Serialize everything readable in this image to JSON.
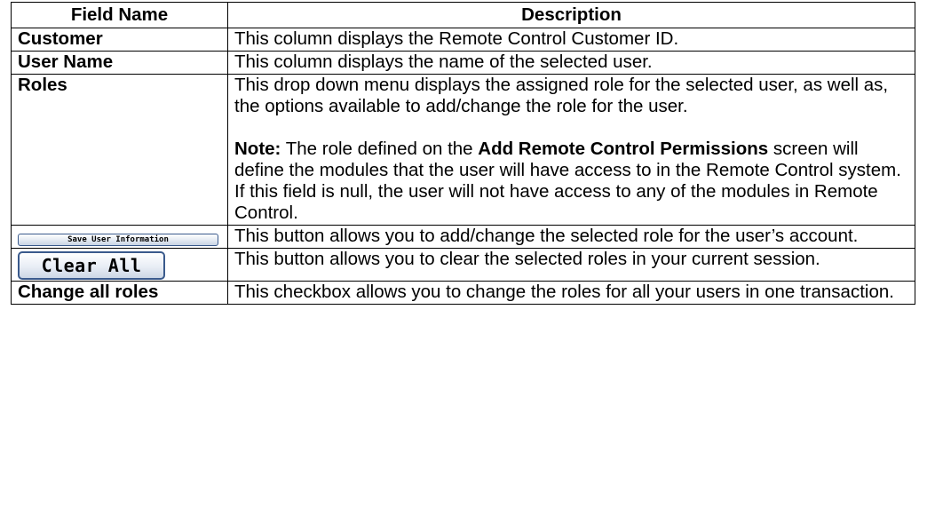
{
  "header": {
    "field_name": "Field Name",
    "description": "Description"
  },
  "rows": [
    {
      "field": "Customer",
      "desc": "This column displays the Remote Control Customer ID."
    },
    {
      "field": "User Name",
      "desc": "This column displays the name of the selected user."
    },
    {
      "field": "Roles",
      "desc": "This drop down menu displays the assigned role for the selected user, as well as, the options available to add/change the role for the user.",
      "note_label": "Note:",
      "note_part1": " The role defined on the ",
      "note_bold": "Add Remote Control Permissions",
      "note_part2": " screen will define the modules that the user will have access to in the Remote Control system.  If this field is null, the user will not have access to any of the modules in Remote Control."
    },
    {
      "button_label": "Save User Information",
      "desc": "This button allows you to add/change the selected role for the user’s account."
    },
    {
      "button_label": "Clear All",
      "desc": "This button allows you to clear the selected roles in your current session."
    },
    {
      "field": "Change all roles",
      "desc": "This checkbox allows you to change the roles for all your users in one transaction."
    }
  ]
}
